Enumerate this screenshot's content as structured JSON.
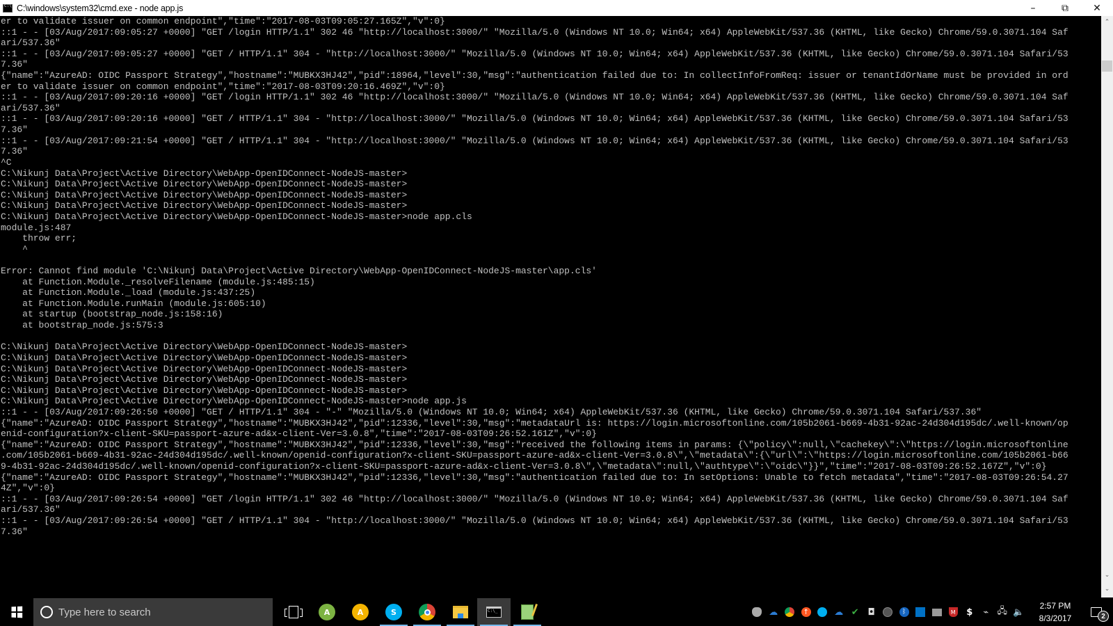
{
  "window": {
    "title": "C:\\windows\\system32\\cmd.exe - node  app.js",
    "icon": "cmd-icon",
    "controls": {
      "minimize": "–",
      "restore": "⧉",
      "close": "✕"
    }
  },
  "console": {
    "lines": [
      "er to validate issuer on common endpoint\",\"time\":\"2017-08-03T09:05:27.165Z\",\"v\":0}",
      "::1 - - [03/Aug/2017:09:05:27 +0000] \"GET /login HTTP/1.1\" 302 46 \"http://localhost:3000/\" \"Mozilla/5.0 (Windows NT 10.0; Win64; x64) AppleWebKit/537.36 (KHTML, like Gecko) Chrome/59.0.3071.104 Saf",
      "ari/537.36\"",
      "::1 - - [03/Aug/2017:09:05:27 +0000] \"GET / HTTP/1.1\" 304 - \"http://localhost:3000/\" \"Mozilla/5.0 (Windows NT 10.0; Win64; x64) AppleWebKit/537.36 (KHTML, like Gecko) Chrome/59.0.3071.104 Safari/53",
      "7.36\"",
      "{\"name\":\"AzureAD: OIDC Passport Strategy\",\"hostname\":\"MUBKX3HJ42\",\"pid\":18964,\"level\":30,\"msg\":\"authentication failed due to: In collectInfoFromReq: issuer or tenantIdOrName must be provided in ord",
      "er to validate issuer on common endpoint\",\"time\":\"2017-08-03T09:20:16.469Z\",\"v\":0}",
      "::1 - - [03/Aug/2017:09:20:16 +0000] \"GET /login HTTP/1.1\" 302 46 \"http://localhost:3000/\" \"Mozilla/5.0 (Windows NT 10.0; Win64; x64) AppleWebKit/537.36 (KHTML, like Gecko) Chrome/59.0.3071.104 Saf",
      "ari/537.36\"",
      "::1 - - [03/Aug/2017:09:20:16 +0000] \"GET / HTTP/1.1\" 304 - \"http://localhost:3000/\" \"Mozilla/5.0 (Windows NT 10.0; Win64; x64) AppleWebKit/537.36 (KHTML, like Gecko) Chrome/59.0.3071.104 Safari/53",
      "7.36\"",
      "::1 - - [03/Aug/2017:09:21:54 +0000] \"GET / HTTP/1.1\" 304 - \"http://localhost:3000/\" \"Mozilla/5.0 (Windows NT 10.0; Win64; x64) AppleWebKit/537.36 (KHTML, like Gecko) Chrome/59.0.3071.104 Safari/53",
      "7.36\"",
      "^C",
      "C:\\Nikunj Data\\Project\\Active Directory\\WebApp-OpenIDConnect-NodeJS-master>",
      "C:\\Nikunj Data\\Project\\Active Directory\\WebApp-OpenIDConnect-NodeJS-master>",
      "C:\\Nikunj Data\\Project\\Active Directory\\WebApp-OpenIDConnect-NodeJS-master>",
      "C:\\Nikunj Data\\Project\\Active Directory\\WebApp-OpenIDConnect-NodeJS-master>",
      "C:\\Nikunj Data\\Project\\Active Directory\\WebApp-OpenIDConnect-NodeJS-master>node app.cls",
      "module.js:487",
      "    throw err;",
      "    ^",
      "",
      "Error: Cannot find module 'C:\\Nikunj Data\\Project\\Active Directory\\WebApp-OpenIDConnect-NodeJS-master\\app.cls'",
      "    at Function.Module._resolveFilename (module.js:485:15)",
      "    at Function.Module._load (module.js:437:25)",
      "    at Function.Module.runMain (module.js:605:10)",
      "    at startup (bootstrap_node.js:158:16)",
      "    at bootstrap_node.js:575:3",
      "",
      "C:\\Nikunj Data\\Project\\Active Directory\\WebApp-OpenIDConnect-NodeJS-master>",
      "C:\\Nikunj Data\\Project\\Active Directory\\WebApp-OpenIDConnect-NodeJS-master>",
      "C:\\Nikunj Data\\Project\\Active Directory\\WebApp-OpenIDConnect-NodeJS-master>",
      "C:\\Nikunj Data\\Project\\Active Directory\\WebApp-OpenIDConnect-NodeJS-master>",
      "C:\\Nikunj Data\\Project\\Active Directory\\WebApp-OpenIDConnect-NodeJS-master>",
      "C:\\Nikunj Data\\Project\\Active Directory\\WebApp-OpenIDConnect-NodeJS-master>node app.js",
      "::1 - - [03/Aug/2017:09:26:50 +0000] \"GET / HTTP/1.1\" 304 - \"-\" \"Mozilla/5.0 (Windows NT 10.0; Win64; x64) AppleWebKit/537.36 (KHTML, like Gecko) Chrome/59.0.3071.104 Safari/537.36\"",
      "{\"name\":\"AzureAD: OIDC Passport Strategy\",\"hostname\":\"MUBKX3HJ42\",\"pid\":12336,\"level\":30,\"msg\":\"metadataUrl is: https://login.microsoftonline.com/105b2061-b669-4b31-92ac-24d304d195dc/.well-known/op",
      "enid-configuration?x-client-SKU=passport-azure-ad&x-client-Ver=3.0.8\",\"time\":\"2017-08-03T09:26:52.161Z\",\"v\":0}",
      "{\"name\":\"AzureAD: OIDC Passport Strategy\",\"hostname\":\"MUBKX3HJ42\",\"pid\":12336,\"level\":30,\"msg\":\"received the following items in params: {\\\"policy\\\":null,\\\"cachekey\\\":\\\"https://login.microsoftonline",
      ".com/105b2061-b669-4b31-92ac-24d304d195dc/.well-known/openid-configuration?x-client-SKU=passport-azure-ad&x-client-Ver=3.0.8\\\",\\\"metadata\\\":{\\\"url\\\":\\\"https://login.microsoftonline.com/105b2061-b66",
      "9-4b31-92ac-24d304d195dc/.well-known/openid-configuration?x-client-SKU=passport-azure-ad&x-client-Ver=3.0.8\\\",\\\"metadata\\\":null,\\\"authtype\\\":\\\"oidc\\\"}}\",\"time\":\"2017-08-03T09:26:52.167Z\",\"v\":0}",
      "{\"name\":\"AzureAD: OIDC Passport Strategy\",\"hostname\":\"MUBKX3HJ42\",\"pid\":12336,\"level\":30,\"msg\":\"authentication failed due to: In setOptions: Unable to fetch metadata\",\"time\":\"2017-08-03T09:26:54.27",
      "4Z\",\"v\":0}",
      "::1 - - [03/Aug/2017:09:26:54 +0000] \"GET /login HTTP/1.1\" 302 46 \"http://localhost:3000/\" \"Mozilla/5.0 (Windows NT 10.0; Win64; x64) AppleWebKit/537.36 (KHTML, like Gecko) Chrome/59.0.3071.104 Saf",
      "ari/537.36\"",
      "::1 - - [03/Aug/2017:09:26:54 +0000] \"GET / HTTP/1.1\" 304 - \"http://localhost:3000/\" \"Mozilla/5.0 (Windows NT 10.0; Win64; x64) AppleWebKit/537.36 (KHTML, like Gecko) Chrome/59.0.3071.104 Safari/53",
      "7.36\""
    ],
    "colors": {
      "background": "#000000",
      "text": "#c0c0c0"
    }
  },
  "scrollbar": {
    "up_arrow": "⌃",
    "down_arrow": "⌄"
  },
  "taskbar": {
    "search_placeholder": "Type here to search",
    "pinned": [
      {
        "name": "task-view-icon",
        "running": false,
        "active": false
      },
      {
        "name": "android-studio-icon",
        "running": false,
        "active": false,
        "color": "#7cb342"
      },
      {
        "name": "android-studio-canary-icon",
        "running": false,
        "active": false,
        "color": "#f4b400"
      },
      {
        "name": "skype-icon",
        "running": true,
        "active": false,
        "color": "#00aff0"
      },
      {
        "name": "chrome-icon",
        "running": true,
        "active": false
      },
      {
        "name": "file-explorer-icon",
        "running": true,
        "active": false
      },
      {
        "name": "cmd-icon",
        "running": true,
        "active": true
      },
      {
        "name": "notepad-plus-icon",
        "running": true,
        "active": false
      }
    ],
    "tray_icons": [
      "node-tray-icon",
      "onedrive-icon",
      "chrome-tray-icon",
      "update-arrow-icon",
      "skype-tray-icon",
      "onedrive-error-icon",
      "checkmark-drive-icon",
      "disk-icon",
      "gauge-icon",
      "bluetooth-icon",
      "intel-graphics-icon",
      "device-icon",
      "mcafee-icon",
      "s-app-icon",
      "power-icon",
      "network-icon",
      "volume-icon"
    ],
    "clock": {
      "time": "2:57 PM",
      "date": "8/3/2017"
    },
    "notification_count": "2"
  }
}
